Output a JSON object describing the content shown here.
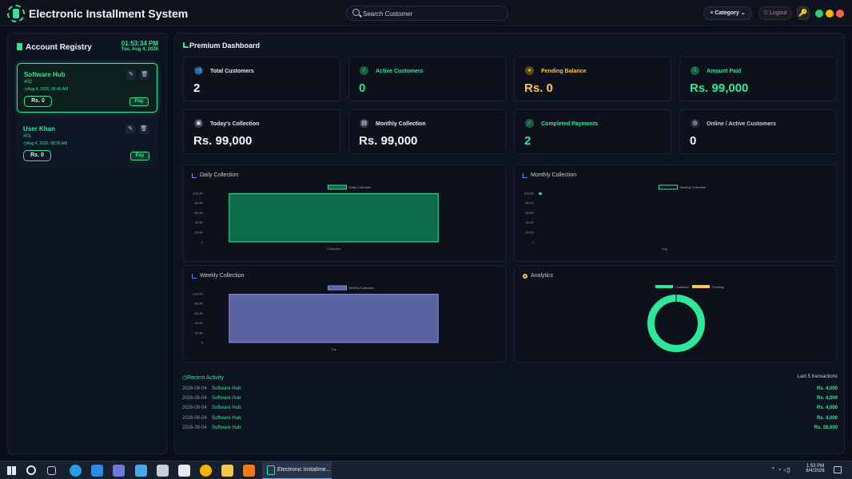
{
  "app": {
    "title": "Electronic Installment System",
    "search_placeholder": "Search Customer",
    "category_label": "≡ Category ⌄",
    "logout_label": "⎋ Logout",
    "window_dots": [
      "#2ecc71",
      "#f5b400",
      "#ff5f57"
    ]
  },
  "sidebar": {
    "title": "Account Registry",
    "time": "01:53:34 PM",
    "date": "Tue, Aug 4, 2026",
    "accounts": [
      {
        "name": "Software Hub",
        "num": "#02",
        "timestamp": "Aug 4, 2026, 08:46 AM",
        "amount": "Rs. 0",
        "pay_label": "Pay"
      },
      {
        "name": "User Khan",
        "num": "#01",
        "timestamp": "Aug 4, 2026, 08:35 AM",
        "amount": "Rs. 0",
        "pay_label": "Pay"
      }
    ]
  },
  "dashboard": {
    "title": "Premium Dashboard",
    "stats": [
      {
        "label": "Total Customers",
        "value": "2",
        "label_color": "#e6e9f0",
        "value_color": "#f2f4f8",
        "icon": "users-icon",
        "icon_glyph": "👥",
        "icon_color": "#3a4150"
      },
      {
        "label": "Active Customers",
        "value": "0",
        "label_color": "#2ee89a",
        "value_color": "#2ee89a",
        "icon": "user-check-icon",
        "icon_glyph": "✓",
        "icon_color": "#1f5b43"
      },
      {
        "label": "Pending Balance",
        "value": "Rs. 0",
        "label_color": "#f5c84b",
        "value_color": "#f5c84b",
        "icon": "clock-icon",
        "icon_glyph": "●",
        "icon_color": "#5c4a18"
      },
      {
        "label": "Amount Paid",
        "value": "Rs. 99,000",
        "label_color": "#2ee89a",
        "value_color": "#2ee89a",
        "icon": "hand-money-icon",
        "icon_glyph": "⇩",
        "icon_color": "#1f5b43"
      },
      {
        "label": "Today's Collection",
        "value": "Rs. 99,000",
        "label_color": "#e6e9f0",
        "value_color": "#f2f4f8",
        "icon": "calendar-day-icon",
        "icon_glyph": "▣",
        "icon_color": "#3a4150"
      },
      {
        "label": "Monthly Collection",
        "value": "Rs. 99,000",
        "label_color": "#e6e9f0",
        "value_color": "#f2f4f8",
        "icon": "calendar-icon",
        "icon_glyph": "▤",
        "icon_color": "#3a4150"
      },
      {
        "label": "Completed Payments",
        "value": "2",
        "label_color": "#2ee89a",
        "value_color": "#2ee89a",
        "icon": "check-circle-icon",
        "icon_glyph": "✓",
        "icon_color": "#1f5b43"
      },
      {
        "label": "Online / Active Customers",
        "value": "0",
        "label_color": "#c9ced8",
        "value_color": "#f2f4f8",
        "icon": "globe-icon",
        "icon_glyph": "◍",
        "icon_color": "#2a3040"
      }
    ],
    "charts": {
      "daily": {
        "title": "Daily Collection"
      },
      "monthly": {
        "title": "Monthly Collection"
      },
      "weekly": {
        "title": "Weekly Collection"
      },
      "analytics": {
        "title": "Analytics"
      }
    },
    "recent": {
      "title": "Recent Activity",
      "subtitle": "Last 5 transactions",
      "rows": [
        {
          "date": "2026-08-04",
          "name": "Software Hub",
          "amount": "Rs. 4,000"
        },
        {
          "date": "2026-08-04",
          "name": "Software Hub",
          "amount": "Rs. 4,000"
        },
        {
          "date": "2026-08-04",
          "name": "Software Hub",
          "amount": "Rs. 4,000"
        },
        {
          "date": "2026-08-04",
          "name": "Software Hub",
          "amount": "Rs. 4,000"
        },
        {
          "date": "2026-08-04",
          "name": "Software Hub",
          "amount": "Rs. 28,000"
        }
      ]
    }
  },
  "chart_data": [
    {
      "type": "bar",
      "title": "Daily Collection",
      "legend": [
        "Daily Collection"
      ],
      "categories": [
        "Collection"
      ],
      "values": [
        99000
      ],
      "ylim": [
        0,
        100000
      ],
      "yticks": [
        "100.0K",
        "80.0K",
        "60.0K",
        "40.0K",
        "20.0K",
        "0"
      ],
      "color": "#0e6a4d",
      "border": "#2ee89a",
      "legend_position": "top"
    },
    {
      "type": "line",
      "title": "Monthly Collection",
      "legend": [
        "Monthly Collection"
      ],
      "categories": [
        "Aug"
      ],
      "values": [
        99000
      ],
      "ylim": [
        0,
        100000
      ],
      "yticks": [
        "100.0K",
        "80.0K",
        "60.0K",
        "40.0K",
        "20.0K",
        "0"
      ],
      "color": "#2ee89a",
      "legend_position": "top"
    },
    {
      "type": "bar",
      "title": "Weekly Collection",
      "legend": [
        "Weekly Collection"
      ],
      "categories": [
        "Tue"
      ],
      "values": [
        99000
      ],
      "ylim": [
        0,
        100000
      ],
      "yticks": [
        "100.0K",
        "80.0K",
        "60.0K",
        "40.0K",
        "20.0K",
        "0"
      ],
      "color": "#5b62a0",
      "border": "#8a92d6",
      "legend_position": "top"
    },
    {
      "type": "pie",
      "title": "Analytics",
      "legend": [
        "Collected",
        "Pending"
      ],
      "values": [
        99000,
        0
      ],
      "colors": [
        "#2ee89a",
        "#f5c84b"
      ],
      "legend_position": "top"
    }
  ],
  "taskbar": {
    "active_window": "Electronic Installme...",
    "time": "1:53 PM",
    "date": "8/4/2026",
    "icons": [
      {
        "name": "windows-start-icon",
        "color": "#e6e9f0"
      },
      {
        "name": "search-icon",
        "color": "#e6e9f0"
      },
      {
        "name": "task-view-icon",
        "color": "#c9ced8"
      },
      {
        "name": "edge-icon",
        "color": "#1fa0e8"
      },
      {
        "name": "vscode-icon",
        "color": "#2c8ae0"
      },
      {
        "name": "app-icon",
        "color": "#6b7bd6"
      },
      {
        "name": "store-icon",
        "color": "#4aa6e8"
      },
      {
        "name": "cloud-icon",
        "color": "#c9ced8"
      },
      {
        "name": "app2-icon",
        "color": "#e6e9f0"
      },
      {
        "name": "chrome-icon",
        "color": "#f2b400"
      },
      {
        "name": "folder-icon",
        "color": "#f2c94c"
      },
      {
        "name": "vlc-icon",
        "color": "#f07b18"
      }
    ]
  }
}
